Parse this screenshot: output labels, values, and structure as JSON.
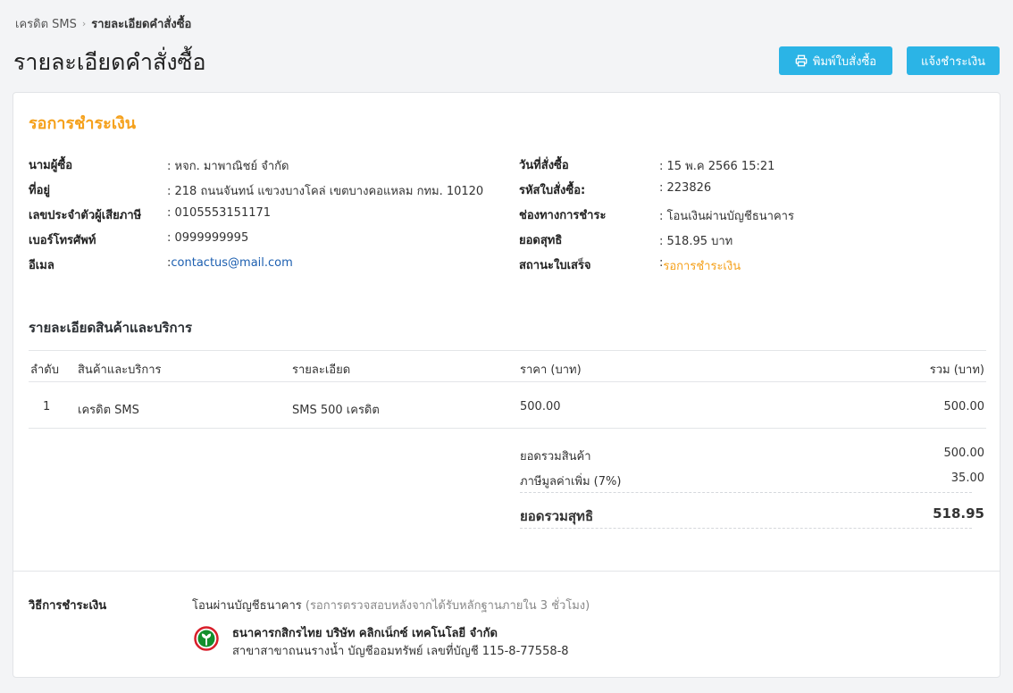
{
  "breadcrumb": {
    "parent": "เครดิต SMS",
    "current": "รายละเอียดคำสั่งซื้อ"
  },
  "page": {
    "title": "รายละเอียดคำสั่งซื้อ"
  },
  "actions": {
    "print_label": "พิมพ์ใบสั่งซื้อ",
    "notify_label": "แจ้งชำระเงิน"
  },
  "status": {
    "title": "รอการชำระเงิน",
    "color": "#f5a11c"
  },
  "buyer": {
    "name_label": "นามผู้ซื้อ",
    "name": ": หจก. มาพาณิชย์ จำกัด",
    "address_label": "ที่อยู่",
    "address": ": 218 ถนนจันทน์ แขวงบางโคล่ เขตบางคอแหลม กทม. 10120",
    "tax_label": "เลขประจำตัวผู้เสียภาษี",
    "tax": ": 0105553151171",
    "phone_label": "เบอร์โทรศัพท์",
    "phone": ": 0999999995",
    "email_label": "อีเมล",
    "email_prefix": ": ",
    "email": "contactus@mail.com"
  },
  "order": {
    "date_label": "วันที่สั่งซื้อ",
    "date": ": 15 พ.ค 2566 15:21",
    "code_label": "รหัสใบสั่งซื้อ:",
    "code": ": 223826",
    "channel_label": "ช่องทางการชำระ",
    "channel": ": โอนเงินผ่านบัญชีธนาคาร",
    "net_label": "ยอดสุทธิ",
    "net": ": 518.95 บาท",
    "receipt_label": "สถานะใบเสร็จ",
    "receipt_prefix": ": ",
    "receipt": "รอการชำระเงิน"
  },
  "items_section": {
    "title": "รายละเอียดสินค้าและบริการ"
  },
  "table": {
    "headers": [
      "ลำดับ",
      "สินค้าและบริการ",
      "รายละเอียด",
      "ราคา (บาท)",
      "รวม (บาท)"
    ],
    "rows": [
      [
        "1",
        "เครดิต SMS",
        "SMS 500 เครดิต",
        "500.00",
        "500.00"
      ]
    ]
  },
  "summary": {
    "subtotal_label": "ยอดรวมสินค้า",
    "subtotal": "500.00",
    "vat_label": "ภาษีมูลค่าเพิ่ม (7%)",
    "vat": "35.00",
    "total_label": "ยอดรวมสุทธิ",
    "total": "518.95"
  },
  "payment": {
    "label": "วิธีการชำระเงิน",
    "method": "โอนผ่านบัญชีธนาคาร",
    "note": " (รอการตรวจสอบหลังจากได้รับหลักฐานภายใน 3 ชั่วโมง)",
    "bank_name": "ธนาคารกสิกรไทย บริษัท คลิกเน็กซ์ เทคโนโลยี จำกัด",
    "bank_account": "สาขาสาขาถนนรางน้ำ บัญชีออมทรัพย์ เลขที่บัญชี 115-8-77558-8",
    "bank_logo_icon": "kasikorn-bank-logo",
    "bank_logo_color": "#138f2d"
  },
  "colors": {
    "accent": "#2bb4e6",
    "pending": "#f5a11c",
    "link": "#1c5fb0"
  }
}
